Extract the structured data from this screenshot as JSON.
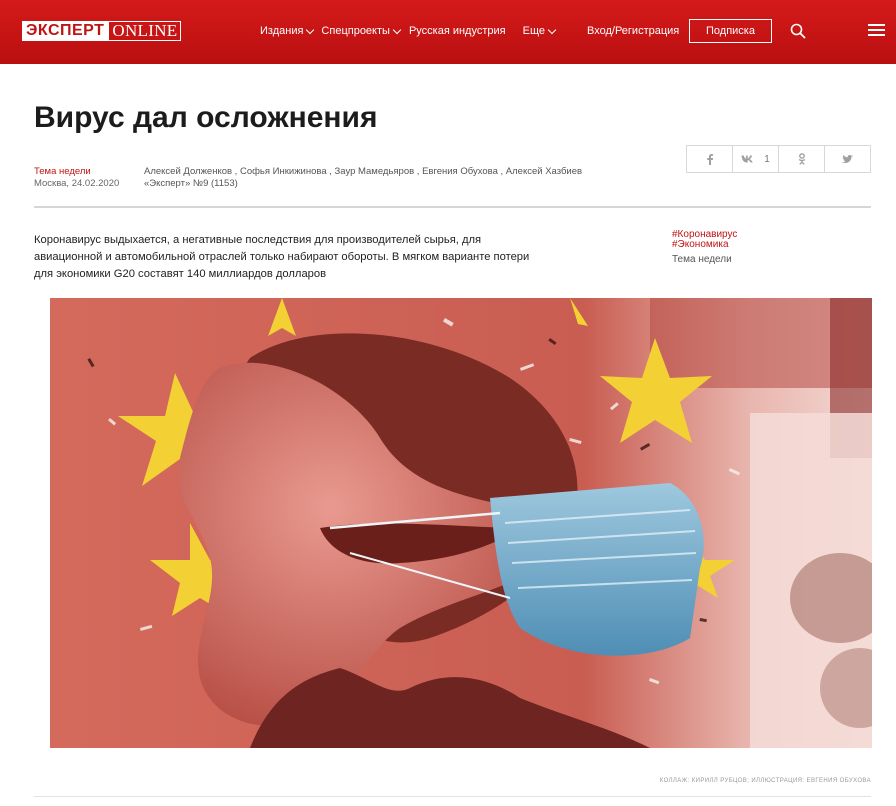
{
  "header": {
    "logo_main": "ЭКСПЕРТ",
    "logo_online": "ONLINE",
    "nav": [
      {
        "label": "Издания",
        "dropdown": true
      },
      {
        "label": "Спецпроекты",
        "dropdown": true
      },
      {
        "label": "Русская индустрия",
        "dropdown": false
      },
      {
        "label": "Еще",
        "dropdown": true
      }
    ],
    "login_label": "Вход/Регистрация",
    "subscribe_label": "Подписка",
    "icons": [
      "search-icon",
      "menu-icon"
    ],
    "brand_color": "#c8141a"
  },
  "article": {
    "title": "Вирус дал осложнения",
    "rubric": "Тема недели",
    "location_date": "Москва, 24.02.2020",
    "authors": "Алексей Долженков , Софья Инкижинова , Заур Мамедьяров , Евгения Обухова , Алексей Хазбиев",
    "issue": "«Эксперт» №9 (1153)",
    "lead": "Коронавирус выдыхается, а негативные последствия для производителей сырья, для авиационной и автомобильной отраслей только набирают обороты. В мягком варианте потери для экономики G20 составят 140 миллиардов долларов",
    "tags": [
      "#Коронавирус",
      "#Экономика"
    ],
    "side_rubric": "Тема недели",
    "image_credit": "КОЛЛАЖ: КИРИЛЛ РУБЦОВ; ИЛЛЮСТРАЦИЯ: ЕВГЕНИЯ ОБУХОВА"
  },
  "share": [
    {
      "icon": "facebook-icon",
      "label": "f",
      "count": ""
    },
    {
      "icon": "vk-icon",
      "label": "vk",
      "count": "1"
    },
    {
      "icon": "odnoklassniki-icon",
      "label": "ok",
      "count": ""
    },
    {
      "icon": "twitter-icon",
      "label": "tw",
      "count": ""
    }
  ]
}
